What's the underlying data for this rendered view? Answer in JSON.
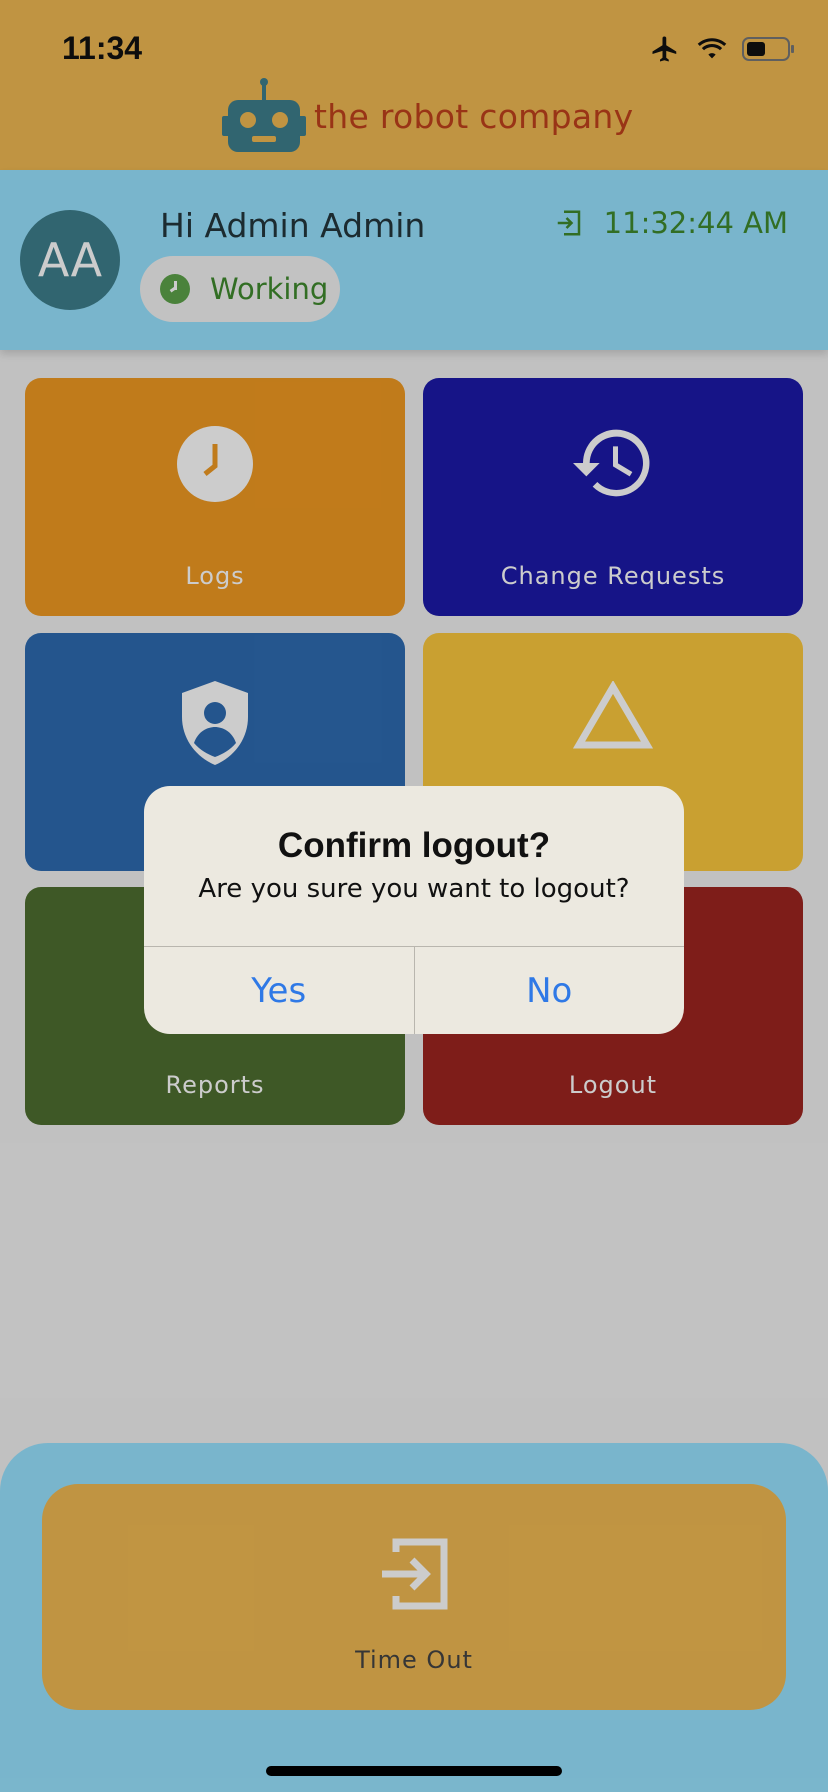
{
  "status_bar": {
    "time": "11:34"
  },
  "brand": {
    "logo_text": "the robot company",
    "logo_color": "#3e7f8d",
    "text_color": "#c0411c"
  },
  "profile": {
    "avatar_initials": "AA",
    "greeting": "Hi Admin Admin",
    "status": "Working",
    "clock_in_time": "11:32:44 AM"
  },
  "tiles": [
    {
      "label": "Logs",
      "icon": "clock-icon",
      "color": "#f19a22"
    },
    {
      "label": "Change Requests",
      "icon": "history-icon",
      "color": "#1c1aa9"
    },
    {
      "label": "",
      "icon": "shield-user-icon",
      "color": "#2e6bb1"
    },
    {
      "label": "",
      "icon": "triangle-icon",
      "color": "#fcc93e"
    },
    {
      "label": "Reports",
      "icon": "reports-icon",
      "color": "#4e6f30"
    },
    {
      "label": "Logout",
      "icon": "logout-icon",
      "color": "#9e2520"
    }
  ],
  "timeout_button": {
    "label": "Time Out",
    "icon": "sign-out-box-icon"
  },
  "dialog": {
    "title": "Confirm logout?",
    "message": "Are you sure you want to logout?",
    "yes_label": "Yes",
    "no_label": "No"
  },
  "colors": {
    "header": "#f1ba53",
    "profile_bg": "#98e3ff",
    "accent_green": "#3f8a2d",
    "dialog_button": "#2f79e6"
  }
}
